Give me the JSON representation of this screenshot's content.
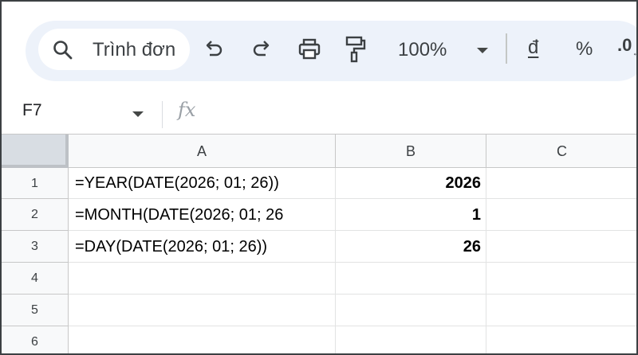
{
  "toolbar": {
    "menu_search_text": "Trình đơn",
    "zoom": "100%",
    "currency_symbol": "đ",
    "percent_symbol": "%",
    "decimal_label": ".0",
    "decimal_arrow": "←"
  },
  "formula_bar": {
    "name_box": "F7",
    "fx_label": "fx"
  },
  "sheet": {
    "columns": [
      "A",
      "B",
      "C"
    ],
    "rows": [
      {
        "num": "1",
        "a": "=YEAR(DATE(2026; 01; 26))",
        "b": "2026",
        "c": ""
      },
      {
        "num": "2",
        "a": "=MONTH(DATE(2026; 01; 26",
        "b": "1",
        "c": ""
      },
      {
        "num": "3",
        "a": "=DAY(DATE(2026; 01; 26))",
        "b": "26",
        "c": ""
      },
      {
        "num": "4",
        "a": "",
        "b": "",
        "c": ""
      },
      {
        "num": "5",
        "a": "",
        "b": "",
        "c": ""
      },
      {
        "num": "6",
        "a": "",
        "b": "",
        "c": ""
      }
    ]
  }
}
